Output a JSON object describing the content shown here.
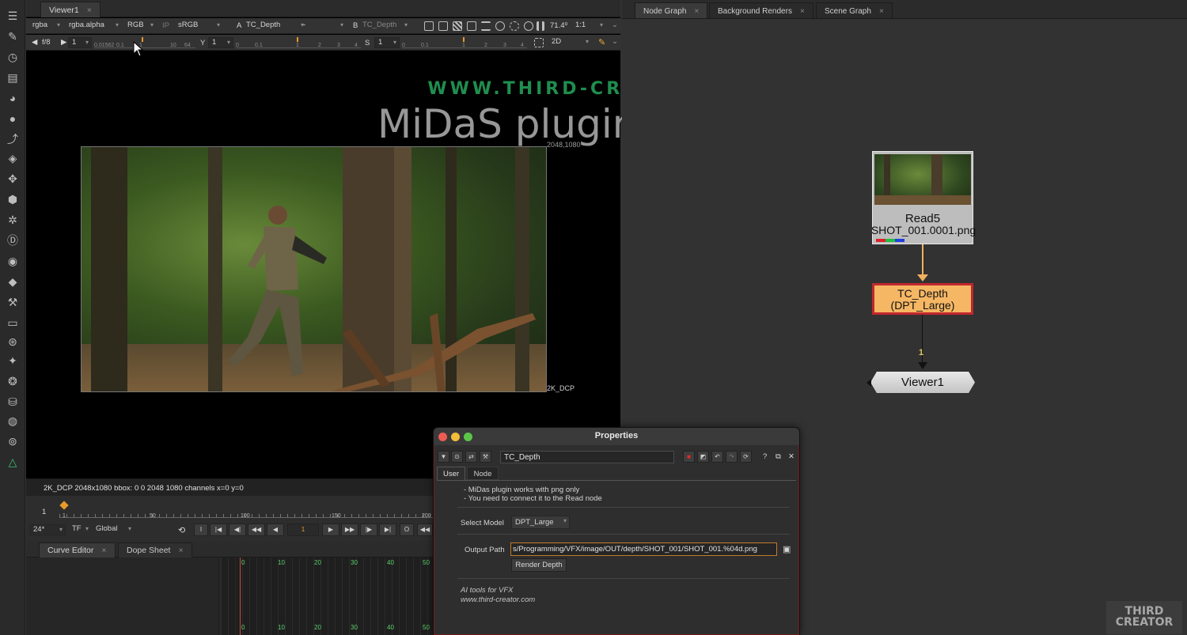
{
  "toolbar": {
    "icons": [
      "menu-icon",
      "paint-brush-icon",
      "clock-icon",
      "channel-icon",
      "color-wheel-icon",
      "circle-icon",
      "curve-icon",
      "layers-icon",
      "transform-icon",
      "3d-cube-icon",
      "particles-icon",
      "deep-icon",
      "view-icon",
      "keyer-icon",
      "wrench-icon",
      "other-icon",
      "merge-icon",
      "plugin-icon",
      "gear-flower-icon",
      "jar-icon",
      "globe-icon",
      "triangle-icon"
    ]
  },
  "viewer": {
    "tab": {
      "label": "Viewer1",
      "close": "×"
    },
    "row1": {
      "channels": "rgba",
      "alpha": "rgba.alpha",
      "colorspace": "RGB",
      "ip": "IP",
      "lut": "sRGB",
      "a_prefix": "A",
      "a_input": "TC_Depth",
      "dash": "-",
      "b_prefix": "B",
      "b_input": "TC_Depth",
      "zoom": "71.4⁰",
      "ratio": "1:1"
    },
    "row2": {
      "fstop": "f/8",
      "fvalue": "1",
      "gain_ticks": [
        "0.01562",
        "0.1",
        "1",
        "10",
        "64"
      ],
      "y_label": "Y",
      "y_value": "1",
      "y_ticks": [
        "0",
        "0.1",
        "1",
        "2",
        "3",
        "4"
      ],
      "s_label": "S",
      "s_value": "1",
      "s_ticks": [
        "0",
        "0.1",
        "1",
        "2",
        "3",
        "4"
      ],
      "view_mode": "2D"
    },
    "watermark_url": "WWW.THIRD-CREATOR.COM",
    "headline": "MiDaS plugin for Nuke",
    "format_top": "2048,1080",
    "format_bottom": "2K_DCP",
    "status": "2K_DCP 2048x1080  bbox: 0 0 2048 1080 channels  x=0 y=0"
  },
  "timeline": {
    "start": "1",
    "ticks": [
      "1",
      "50",
      "100",
      "150",
      "200"
    ],
    "fps": "24*",
    "tf": "TF",
    "scope": "Global",
    "current_frame": "1",
    "buttons": [
      "I",
      "|◀",
      "◀|",
      "◀◀",
      "◀",
      "▶",
      "▶▶",
      "|▶",
      "▶|",
      "O"
    ]
  },
  "bottom_tabs": {
    "curve_editor": "Curve Editor",
    "dope_sheet": "Dope Sheet",
    "ticks": [
      "0",
      "10",
      "20",
      "30",
      "40",
      "50"
    ]
  },
  "node_graph": {
    "tabs": [
      "Node Graph",
      "Background Renders",
      "Scene Graph"
    ],
    "read_node": {
      "name": "Read5",
      "file": "SHOT_001.0001.png"
    },
    "depth_node": {
      "name": "TC_Depth",
      "sub": "(DPT_Large)"
    },
    "edge_label": "1",
    "viewer_node": "Viewer1"
  },
  "properties": {
    "title": "Properties",
    "node_name": "TC_Depth",
    "tabs": [
      "User",
      "Node"
    ],
    "notes": [
      "- MiDas plugin works with png only",
      "- You need to connect it to the Read node"
    ],
    "select_model_label": "Select Model",
    "select_model_value": "DPT_Large",
    "output_path_label": "Output Path",
    "output_path_value": "s/Programming/VFX/image/OUT/depth/SHOT_001/SHOT_001.%04d.png",
    "render_button": "Render Depth",
    "footer1": "AI tools for VFX",
    "footer2": "www.third-creator.com",
    "help": "?"
  },
  "logo": {
    "line1": "THIRD",
    "line2": "CREATOR"
  },
  "colors": {
    "accent_orange": "#e89a2a",
    "node_depth": "#f6b764",
    "node_border_red": "#c0272d",
    "watermark_green": "#1f8e4e"
  }
}
